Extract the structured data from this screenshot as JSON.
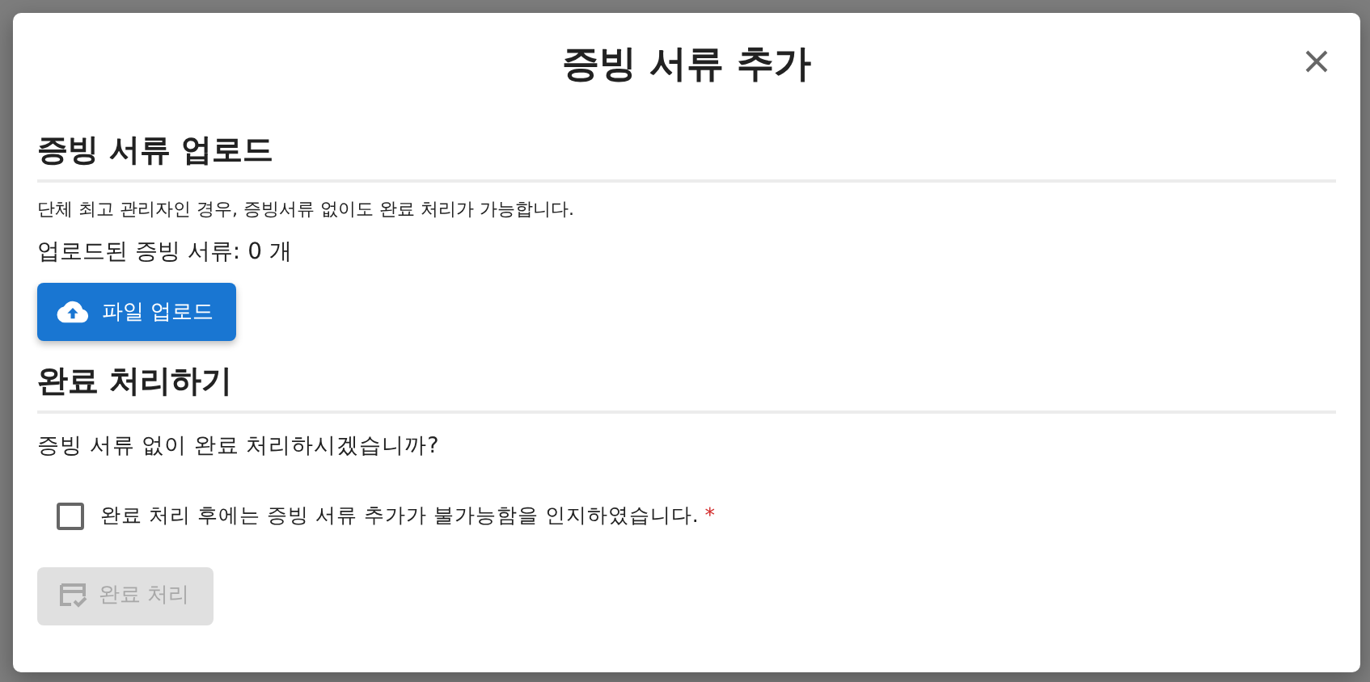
{
  "dialog": {
    "title": "증빙 서류 추가"
  },
  "upload_section": {
    "heading": "증빙 서류 업로드",
    "note": "단체 최고 관리자인 경우, 증빙서류 없이도 완료 처리가 가능합니다.",
    "count_text": "업로드된 증빙 서류: 0 개",
    "upload_button": {
      "label": "파일 업로드",
      "disabled": false
    }
  },
  "complete_section": {
    "heading": "완료 처리하기",
    "question": "증빙 서류 없이 완료 처리하시겠습니까?",
    "acknowledge": {
      "label": "완료 처리 후에는 증빙 서류 추가가 불가능함을 인지하였습니다.",
      "required_mark": "*",
      "checked": false
    },
    "complete_button": {
      "label": "완료 처리",
      "disabled": true
    }
  }
}
